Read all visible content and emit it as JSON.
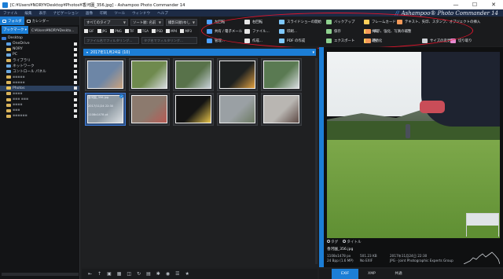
{
  "window": {
    "title": "[C:¥Users¥NORY¥Desktop¥Photos¥香河園_356.jpg] - Ashampoo Photo Commander 14",
    "minimize": "—",
    "maximize": "☐",
    "close": "✕"
  },
  "menu": {
    "items": [
      "ファイル",
      "編集",
      "表示",
      "ナビゲーション",
      "画像",
      "印刷",
      "ツール",
      "ウィンドウ",
      "ヘルプ"
    ],
    "brand": "Ashampoo® Photo Commander 14",
    "brand_prefix": "//"
  },
  "left_panel": {
    "tabs": [
      {
        "label": "フォルダ"
      },
      {
        "label": "カレンダー"
      }
    ],
    "bookmark_label": "ブックマーク ▾",
    "path": "C:¥Users¥NORY¥Deskto...",
    "tree": [
      {
        "label": "Desktop",
        "color": "#3a7bd5"
      },
      {
        "label": "OneDrive",
        "color": "#5aa0e6"
      },
      {
        "label": "NORY",
        "color": "#d9b35a"
      },
      {
        "label": "PC",
        "color": "#6aa8e0"
      },
      {
        "label": "ライブラリ",
        "color": "#d9b35a"
      },
      {
        "label": "ネットワーク",
        "color": "#6aa8e0"
      },
      {
        "label": "コントロール パネル",
        "color": "#6aa8e0"
      },
      {
        "label": "▪▪▪▪▪",
        "color": "#d9b35a"
      },
      {
        "label": "▪▪▪▪▪",
        "color": "#d9b35a"
      },
      {
        "label": "Photos",
        "color": "#e8c35a"
      },
      {
        "label": "▪▪▪▪",
        "color": "#d9b35a"
      },
      {
        "label": "▪▪▪ ▪▪▪",
        "color": "#d9b35a"
      },
      {
        "label": "▪▪▪▪",
        "color": "#d9b35a"
      },
      {
        "label": "▪▪▪",
        "color": "#d9b35a"
      },
      {
        "label": "▪▪▪▪▪▪",
        "color": "#d9b35a"
      }
    ]
  },
  "filters": {
    "type_select": "すべてのタイプ",
    "sort_select": "ソート順: 名前",
    "date_select": "撮影日順(ゆし",
    "types": [
      "GIF",
      "JPG",
      "PNG",
      "TIF",
      "TGA",
      "PSD",
      "MP4",
      "MP3"
    ],
    "search_placeholder": "ファイル名でフィルタリング...",
    "search2_placeholder": "タグ名でフィルタリング..."
  },
  "ribbon": {
    "col1": [
      "左回転",
      "共有 / 電子メール",
      "管理..."
    ],
    "col2": [
      "右回転",
      "ファイル...",
      "作成..."
    ],
    "col3": [
      "スライドショーの開始",
      "印刷...",
      "PDF の作成"
    ],
    "col4": [
      "バックアップ",
      "保存",
      "エクスポート"
    ],
    "col5": [
      "フレームカード",
      "共有",
      "最適化"
    ],
    "col6": [
      "テキスト、矢印、スタンプ、オブジェクトの挿入",
      "表示、強化、写真の補整",
      "色"
    ],
    "col7": [
      "",
      "",
      "サイズの変更"
    ],
    "col8": [
      "",
      "",
      "切り取り"
    ]
  },
  "gallery": {
    "date_header": "2017年11月24日 (10)",
    "thumbs": [
      {
        "color": "#6d86a6",
        "accent": "#c9a27e"
      },
      {
        "color": "#6f8a4e",
        "accent": "#d7dbe0"
      },
      {
        "color": "#58724a",
        "accent": "#c8d0d8"
      },
      {
        "color": "#1d2020",
        "accent": "#e0a040"
      },
      {
        "color": "#5a7a52",
        "accent": "#d8dce0"
      },
      {
        "color": "#8f9aa3",
        "accent": "#d9dee2"
      },
      {
        "color": "#8c7a6e",
        "accent": "#b85a54"
      },
      {
        "color": "#141414",
        "accent": "#e7c44a"
      },
      {
        "color": "#9aa0a4",
        "accent": "#6c7a62"
      },
      {
        "color": "#b9b6b2",
        "accent": "#5e4a45"
      }
    ],
    "selected_caption_lines": [
      "香河園_356.jpg",
      "2017/11/24 22:30",
      "1108x1478 pt"
    ]
  },
  "viewer": {
    "controls": [
      "タグ",
      "タイトル"
    ],
    "filename": "香河園_356.jpg",
    "info_left": [
      "1108x1478 px",
      "24 Bpp (1.6 MP)"
    ],
    "info_mid": [
      "501.23 KB",
      "No EXIF"
    ],
    "info_right": [
      "2017年11月24日 22:30",
      "JPG - Joint Photographic Experts Group"
    ]
  },
  "bottom_right": {
    "tabs": [
      "EXIF",
      "XMP",
      "共通"
    ]
  }
}
